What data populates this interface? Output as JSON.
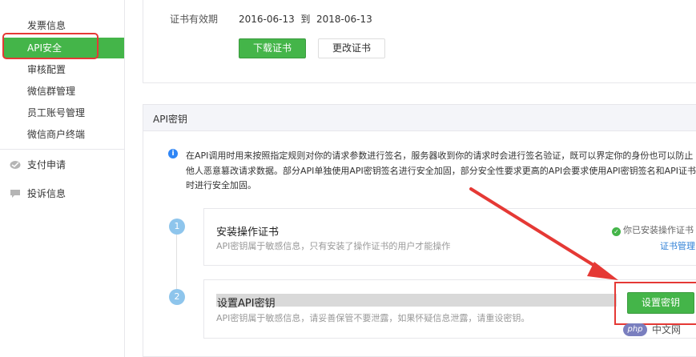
{
  "sidebar": {
    "items": [
      {
        "label": "发票信息"
      },
      {
        "label": "API安全"
      },
      {
        "label": "审核配置"
      },
      {
        "label": "微信群管理"
      },
      {
        "label": "员工账号管理"
      },
      {
        "label": "微信商户终端"
      }
    ],
    "groups": [
      {
        "label": "支付申请",
        "icon": "payment-icon"
      },
      {
        "label": "投诉信息",
        "icon": "message-icon"
      }
    ]
  },
  "certificate": {
    "validity_label": "证书有效期",
    "validity_value": "2016-06-13  到  2018-06-13",
    "download_label": "下载证书",
    "change_label": "更改证书"
  },
  "api_key": {
    "section_title": "API密钥",
    "info_lines": [
      "在API调用时用来按照指定规则对你的请求参数进行签名，服务器收到你的请求时会进行签名验证，既可以界定你的身份也可以防止",
      "他人恶意篡改请求数据。部分API单独使用API密钥签名进行安全加固，部分安全性要求更高的API会要求使用API密钥签名和API证书",
      "时进行安全加固。"
    ],
    "steps": [
      {
        "number": "1",
        "title": "安装操作证书",
        "desc": "API密钥属于敏感信息，只有安装了操作证书的用户才能操作",
        "status": "你已安装操作证书",
        "link": "证书管理"
      },
      {
        "number": "2",
        "title": "设置API密钥",
        "desc": "API密钥属于敏感信息，请妥善保管不要泄露，如果怀疑信息泄露，请重设密钥。",
        "button": "设置密钥"
      }
    ]
  },
  "watermark": {
    "badge": "php",
    "text": "中文网"
  },
  "colors": {
    "brand_green": "#44b549",
    "highlight_red": "#e53935",
    "link_blue": "#2e7fd6"
  }
}
